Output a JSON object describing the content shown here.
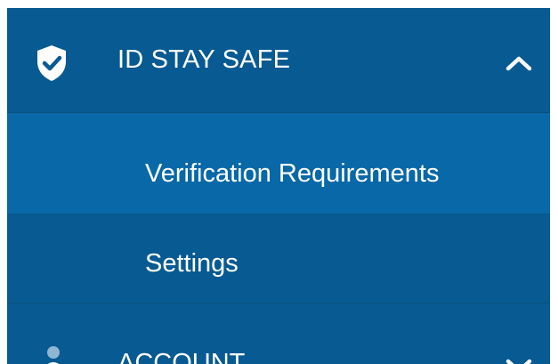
{
  "menu": {
    "section": {
      "label": "ID STAY SAFE",
      "icon": "shield-check-icon",
      "state": "expanded",
      "items": [
        {
          "label": "Verification Requirements",
          "active": true
        },
        {
          "label": "Settings",
          "active": false
        }
      ]
    },
    "next_section": {
      "label": "ACCOUNT",
      "icon": "person-icon",
      "state": "collapsed"
    }
  },
  "colors": {
    "menu_bg": "#075a92",
    "active_item_bg": "#0868a8",
    "text": "#ffffff",
    "icon_muted": "#8fb6d3"
  }
}
